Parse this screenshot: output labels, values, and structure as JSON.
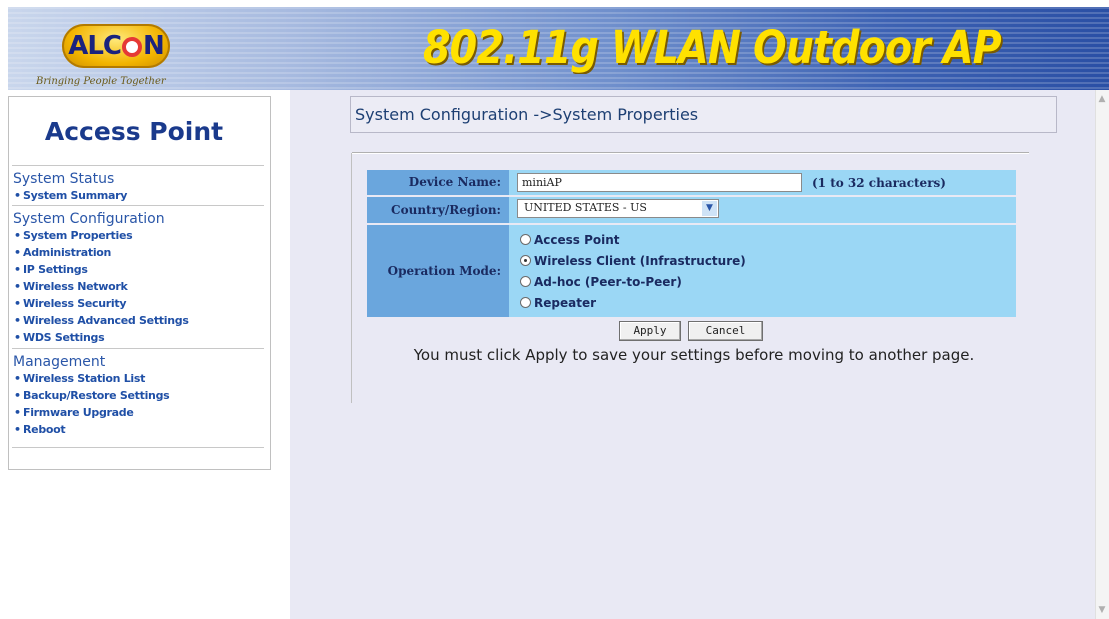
{
  "header": {
    "logo_text": "ALCON",
    "tagline": "Bringing People Together",
    "product_title": "802.11g WLAN Outdoor AP",
    "title_color": "#ffe100"
  },
  "nav": {
    "title": "Access Point",
    "sections": [
      {
        "label": "System Status",
        "items": [
          "System Summary"
        ]
      },
      {
        "label": "System Configuration",
        "items": [
          "System Properties",
          "Administration",
          "IP Settings",
          "Wireless Network",
          "Wireless Security",
          "Wireless Advanced Settings",
          "WDS Settings"
        ]
      },
      {
        "label": "Management",
        "items": [
          "Wireless Station List",
          "Backup/Restore Settings",
          "Firmware Upgrade",
          "Reboot"
        ]
      }
    ],
    "bullet": "•"
  },
  "content": {
    "breadcrumb": "System Configuration ->System Properties",
    "form": {
      "device_name_label": "Device Name:",
      "device_name_value": "miniAP",
      "device_name_hint": "(1 to 32 characters)",
      "country_label": "Country/Region:",
      "country_value": "UNITED STATES - US",
      "operation_mode_label": "Operation Mode:",
      "operation_modes": [
        "Access Point",
        "Wireless Client (Infrastructure)",
        "Ad-hoc (Peer-to-Peer)",
        "Repeater"
      ],
      "selected_mode": "Wireless Client (Infrastructure)"
    },
    "apply_label": "Apply",
    "cancel_label": "Cancel",
    "notice": "You must click Apply to save your settings before moving to another page."
  },
  "colors": {
    "label_bg": "#6aa6dd",
    "value_bg": "#9bd7f5",
    "content_bg": "#e9e9f4",
    "nav_text": "#1f4fa6"
  },
  "icons": [
    "chevron-down-icon",
    "scroll-up-arrow-icon",
    "scroll-down-arrow-icon",
    "radio-icon"
  ]
}
